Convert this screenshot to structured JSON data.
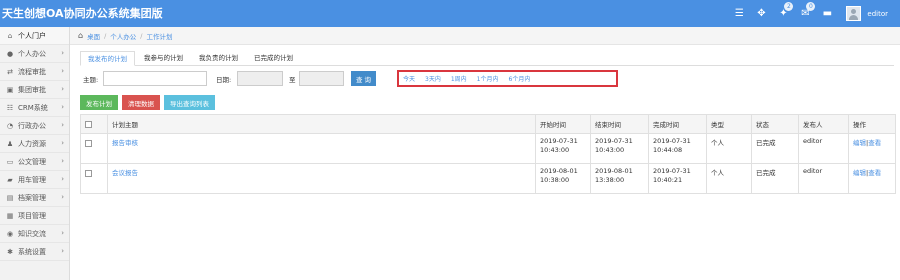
{
  "app": {
    "title": "天生创想OA协同办公系统集团版"
  },
  "topbar": {
    "icons": [
      {
        "name": "menu-icon",
        "glyph": "☰",
        "badge": ""
      },
      {
        "name": "fullscreen-icon",
        "glyph": "✥",
        "badge": ""
      },
      {
        "name": "message-icon",
        "glyph": "✦",
        "badge": "2"
      },
      {
        "name": "mail-icon",
        "glyph": "✉",
        "badge": "0"
      },
      {
        "name": "chat-icon",
        "glyph": "▬",
        "badge": ""
      }
    ],
    "username": "editor"
  },
  "sidebar": {
    "items": [
      {
        "label": "个人门户",
        "icon": "home-icon",
        "glyph": "⌂",
        "chevron": ""
      },
      {
        "label": "个人办公",
        "icon": "user-icon",
        "glyph": "●",
        "chevron": "›"
      },
      {
        "label": "流程审批",
        "icon": "flow-icon",
        "glyph": "⇄",
        "chevron": "›"
      },
      {
        "label": "集团审批",
        "icon": "group-icon",
        "glyph": "▣",
        "chevron": "›"
      },
      {
        "label": "CRM系统",
        "icon": "crm-icon",
        "glyph": "☷",
        "chevron": "›"
      },
      {
        "label": "行政办公",
        "icon": "admin-icon",
        "glyph": "◔",
        "chevron": "›"
      },
      {
        "label": "人力资源",
        "icon": "hr-icon",
        "glyph": "♟",
        "chevron": "›"
      },
      {
        "label": "公文管理",
        "icon": "document-icon",
        "glyph": "▭",
        "chevron": "›"
      },
      {
        "label": "用车管理",
        "icon": "car-icon",
        "glyph": "▰",
        "chevron": "›"
      },
      {
        "label": "档案管理",
        "icon": "archive-icon",
        "glyph": "▤",
        "chevron": "›"
      },
      {
        "label": "项目管理",
        "icon": "project-icon",
        "glyph": "▦",
        "chevron": ""
      },
      {
        "label": "知识交流",
        "icon": "knowledge-icon",
        "glyph": "◉",
        "chevron": "›"
      },
      {
        "label": "系统设置",
        "icon": "settings-icon",
        "glyph": "✱",
        "chevron": "›"
      }
    ]
  },
  "breadcrumb": {
    "items": [
      "桌面",
      "个人办公",
      "工作计划"
    ]
  },
  "tabs": [
    "我发布的计划",
    "我参与的计划",
    "我负责的计划",
    "已完成的计划"
  ],
  "filter": {
    "subject_label": "主题:",
    "subject_value": "",
    "date_label": "日期:",
    "date_from": "",
    "to_label": "至",
    "date_to": "",
    "query_label": "查 询",
    "ranges": [
      "今天",
      "3天内",
      "1周内",
      "1个月内",
      "6个月内"
    ]
  },
  "actions": {
    "publish": "发布计划",
    "clear": "清理数据",
    "export": "导出查询列表"
  },
  "table": {
    "headers": [
      "",
      "计划主题",
      "开始时间",
      "结束时间",
      "完成时间",
      "类型",
      "状态",
      "发布人",
      "操作"
    ],
    "rows": [
      {
        "subject": "报告审核",
        "start": [
          "2019-07-31",
          "10:43:00"
        ],
        "end": [
          "2019-07-31",
          "10:43:00"
        ],
        "done": [
          "2019-07-31",
          "10:44:08"
        ],
        "type": "个人",
        "status": "已完成",
        "publisher": "editor",
        "op_edit": "编辑",
        "op_sep": "|",
        "op_view": "查看"
      },
      {
        "subject": "会议报告",
        "start": [
          "2019-08-01",
          "10:38:00"
        ],
        "end": [
          "2019-08-01",
          "13:38:00"
        ],
        "done": [
          "2019-07-31",
          "10:40:21"
        ],
        "type": "个人",
        "status": "已完成",
        "publisher": "editor",
        "op_edit": "编辑",
        "op_sep": "|",
        "op_view": "查看"
      }
    ]
  },
  "colors": {
    "topbar": "#4a90e2",
    "highlight_box": "#d9363e",
    "link": "#4a90e2"
  }
}
